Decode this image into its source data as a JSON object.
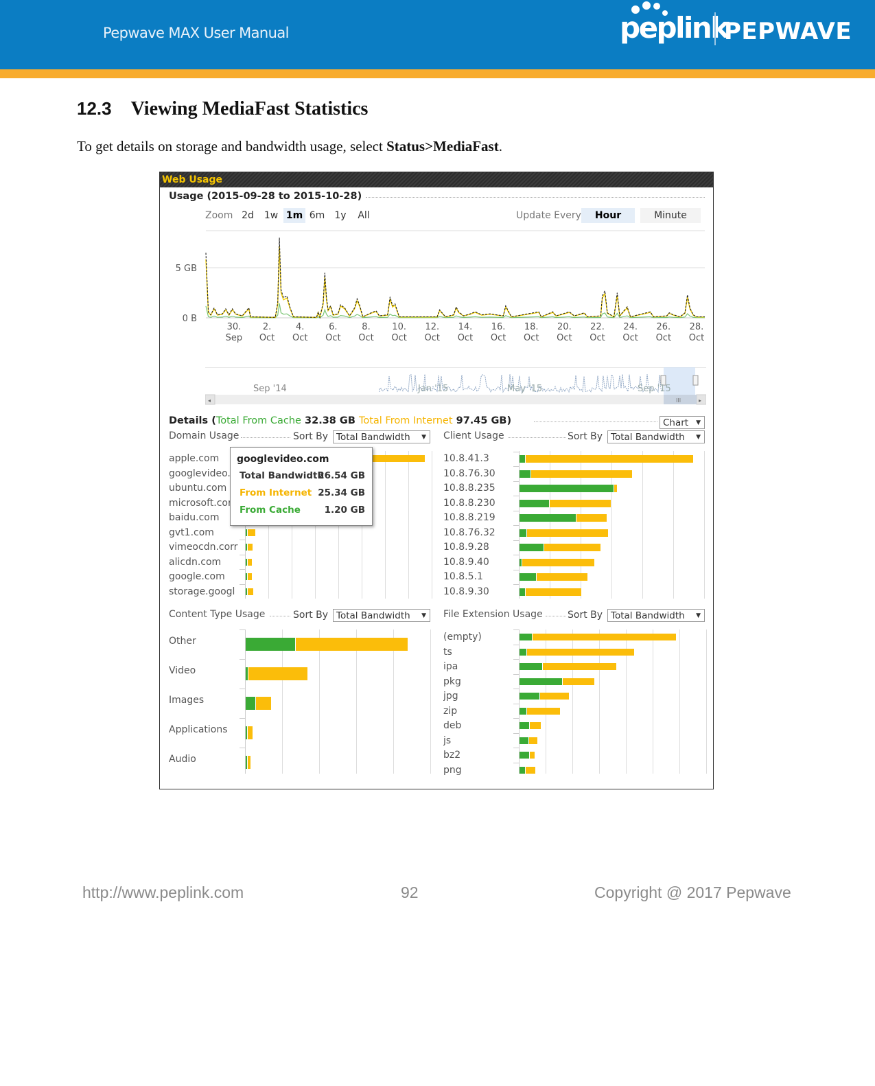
{
  "header": {
    "manual_title": "Pepwave MAX User Manual",
    "logo_left": "peplink",
    "logo_right": "PEPWAVE",
    "colors": {
      "band": "#0b7dc3",
      "strip": "#f8ac2e"
    }
  },
  "section": {
    "number": "12.3",
    "title": "Viewing MediaFast Statistics",
    "intro_prefix": "To get details on storage and bandwidth usage, select ",
    "intro_bold": "Status>MediaFast",
    "intro_suffix": "."
  },
  "panel": {
    "title": "Web Usage",
    "usage_heading": "Usage (2015-09-28 to 2015-10-28)",
    "zoom_label": "Zoom",
    "zoom_options": [
      "2d",
      "1w",
      "1m",
      "6m",
      "1y",
      "All"
    ],
    "zoom_active": "1m",
    "update_label": "Update Every",
    "update_options": [
      "Hour",
      "Minute"
    ],
    "update_active": "Hour",
    "navigator_labels": [
      "Sep '14",
      "Jan '15",
      "May '15",
      "Sep '15"
    ],
    "details": {
      "prefix": "Details (",
      "cache_label": "Total From Cache",
      "cache_value": "32.38 GB",
      "internet_label": "Total From Internet",
      "internet_value": "97.45 GB",
      "suffix": ")",
      "view_select": "Chart"
    },
    "sort_by_label": "Sort By",
    "sort_value": "Total Bandwidth",
    "colors": {
      "cache": "#3aaa35",
      "internet": "#fbbd0a",
      "total_line": "#222222"
    }
  },
  "chart_data": [
    {
      "type": "line",
      "title": "Usage (2015-09-28 to 2015-10-28)",
      "ylabel": "",
      "y_ticks": [
        "0 B",
        "5 GB"
      ],
      "ylim_gb": [
        0,
        8.5
      ],
      "x_ticks": [
        "30. Sep",
        "2. Oct",
        "4. Oct",
        "6. Oct",
        "8. Oct",
        "10. Oct",
        "12. Oct",
        "14. Oct",
        "16. Oct",
        "18. Oct",
        "20. Oct",
        "22. Oct",
        "24. Oct",
        "26. Oct",
        "28. Oct"
      ],
      "x_range_days": [
        28.3,
        58.5
      ],
      "series": [
        {
          "name": "Total",
          "style": "dashed-black",
          "points": [
            [
              28.3,
              6.5
            ],
            [
              28.45,
              0.6
            ],
            [
              28.6,
              0.3
            ],
            [
              28.8,
              1.0
            ],
            [
              29.0,
              0.3
            ],
            [
              29.3,
              0.4
            ],
            [
              29.5,
              0.9
            ],
            [
              29.7,
              0.3
            ],
            [
              29.9,
              0.9
            ],
            [
              30.1,
              0.4
            ],
            [
              30.5,
              0.2
            ],
            [
              30.9,
              1.0
            ],
            [
              31.0,
              0.1
            ],
            [
              32.5,
              0.05
            ],
            [
              32.65,
              1.5
            ],
            [
              32.75,
              8.0
            ],
            [
              32.85,
              2.8
            ],
            [
              33.0,
              2.0
            ],
            [
              33.2,
              2.2
            ],
            [
              33.4,
              1.0
            ],
            [
              33.6,
              0.1
            ],
            [
              35.0,
              0.05
            ],
            [
              35.1,
              0.6
            ],
            [
              35.2,
              0.05
            ],
            [
              35.4,
              1.5
            ],
            [
              35.5,
              4.5
            ],
            [
              35.6,
              2.0
            ],
            [
              35.7,
              0.8
            ],
            [
              35.85,
              1.2
            ],
            [
              36.0,
              0.3
            ],
            [
              36.3,
              0.4
            ],
            [
              36.45,
              1.3
            ],
            [
              36.7,
              1.0
            ],
            [
              37.0,
              0.2
            ],
            [
              37.3,
              1.0
            ],
            [
              37.45,
              1.9
            ],
            [
              37.6,
              1.3
            ],
            [
              37.8,
              0.1
            ],
            [
              38.3,
              0.5
            ],
            [
              38.6,
              0.7
            ],
            [
              38.8,
              0.2
            ],
            [
              39.3,
              0.3
            ],
            [
              39.45,
              2.1
            ],
            [
              39.6,
              1.2
            ],
            [
              39.75,
              1.4
            ],
            [
              40.0,
              0.1
            ],
            [
              42.3,
              0.1
            ],
            [
              42.45,
              0.8
            ],
            [
              42.6,
              0.5
            ],
            [
              42.8,
              0.1
            ],
            [
              43.3,
              0.3
            ],
            [
              43.45,
              1.1
            ],
            [
              43.6,
              0.6
            ],
            [
              43.9,
              0.2
            ],
            [
              44.3,
              0.4
            ],
            [
              44.6,
              0.6
            ],
            [
              45.0,
              0.3
            ],
            [
              45.5,
              0.4
            ],
            [
              46.3,
              0.2
            ],
            [
              46.45,
              1.2
            ],
            [
              46.6,
              0.7
            ],
            [
              46.8,
              0.1
            ],
            [
              48.45,
              0.6
            ],
            [
              48.6,
              0.1
            ],
            [
              49.3,
              0.6
            ],
            [
              49.5,
              0.2
            ],
            [
              50.1,
              0.5
            ],
            [
              50.3,
              0.6
            ],
            [
              50.6,
              0.2
            ],
            [
              51.2,
              0.5
            ],
            [
              51.4,
              0.1
            ],
            [
              52.2,
              0.2
            ],
            [
              52.3,
              2.2
            ],
            [
              52.45,
              2.7
            ],
            [
              52.6,
              0.5
            ],
            [
              53.0,
              0.1
            ],
            [
              53.2,
              2.5
            ],
            [
              53.35,
              0.2
            ],
            [
              53.6,
              0.7
            ],
            [
              53.8,
              1.1
            ],
            [
              54.0,
              0.1
            ],
            [
              55.2,
              0.6
            ],
            [
              55.4,
              0.1
            ],
            [
              56.2,
              0.2
            ],
            [
              56.35,
              0.5
            ],
            [
              56.6,
              0.3
            ],
            [
              57.0,
              0.1
            ],
            [
              57.3,
              0.5
            ],
            [
              57.45,
              2.3
            ],
            [
              57.6,
              1.0
            ],
            [
              57.8,
              0.3
            ],
            [
              58.0,
              0.1
            ],
            [
              58.5,
              0.1
            ]
          ]
        },
        {
          "name": "From Internet",
          "style": "yellow",
          "note": "closely follows Total, slightly lower"
        },
        {
          "name": "From Cache",
          "style": "green",
          "note": "mostly near zero with small bumps"
        }
      ]
    },
    {
      "type": "bar",
      "stacked": true,
      "orientation": "horizontal",
      "title": "Domain Usage",
      "categories": [
        "apple.com",
        "googlevideo.com",
        "ubuntu.com",
        "microsoft.com",
        "baidu.com",
        "gvt1.com",
        "vimeocdn.com",
        "alicdn.com",
        "google.com",
        "storage.googleapis.com"
      ],
      "category_labels_shown": [
        "apple.com",
        "googlevideo.",
        "ubuntu.com",
        "microsoft.cor",
        "baidu.com",
        "gvt1.com",
        "vimeocdn.corr",
        "alicdn.com",
        "google.com",
        "storage.googl"
      ],
      "series": [
        {
          "name": "From Cache",
          "values_gb": [
            0.3,
            1.2,
            0.2,
            0.2,
            0.1,
            0.05,
            0.3,
            0.2,
            0.1,
            0.1
          ]
        },
        {
          "name": "From Internet",
          "values_gb": [
            53.5,
            25.34,
            16,
            12,
            8,
            2.3,
            1.6,
            1.3,
            1.4,
            1.7
          ]
        }
      ],
      "tooltip": {
        "title": "googlevideo.com",
        "rows": [
          {
            "label": "Total Bandwidth",
            "value": "26.54 GB"
          },
          {
            "label": "From Internet",
            "value": "25.34 GB"
          },
          {
            "label": "From Cache",
            "value": "1.20 GB"
          }
        ]
      },
      "xlim_gb": [
        0,
        60
      ]
    },
    {
      "type": "bar",
      "stacked": true,
      "orientation": "horizontal",
      "title": "Client Usage",
      "categories": [
        "10.8.41.3",
        "10.8.76.30",
        "10.8.8.235",
        "10.8.8.230",
        "10.8.8.219",
        "10.8.76.32",
        "10.8.9.28",
        "10.8.9.40",
        "10.8.5.1",
        "10.8.9.30"
      ],
      "series": [
        {
          "name": "From Cache",
          "values_rel": [
            0.7,
            1.4,
            12.2,
            3.8,
            7.3,
            0.9,
            3.1,
            0.3,
            2.1,
            0.7
          ]
        },
        {
          "name": "From Internet",
          "values_rel": [
            21.7,
            13.1,
            0.3,
            7.9,
            3.9,
            10.5,
            7.3,
            9.3,
            6.6,
            7.2
          ]
        }
      ],
      "xlim_rel": [
        0,
        24
      ]
    },
    {
      "type": "bar",
      "stacked": true,
      "orientation": "horizontal",
      "title": "Content Type Usage",
      "categories": [
        "Other",
        "Video",
        "Images",
        "Applications",
        "Audio"
      ],
      "series": [
        {
          "name": "From Cache",
          "values_rel": [
            13.3,
            0.6,
            2.5,
            0.3,
            0.3
          ]
        },
        {
          "name": "From Internet",
          "values_rel": [
            30.3,
            15.9,
            4.2,
            1.4,
            0.9
          ]
        }
      ],
      "xlim_rel": [
        0,
        50
      ]
    },
    {
      "type": "bar",
      "stacked": true,
      "orientation": "horizontal",
      "title": "File Extension Usage",
      "categories": [
        "(empty)",
        "ts",
        "ipa",
        "pkg",
        "jpg",
        "zip",
        "deb",
        "js",
        "bz2",
        "png"
      ],
      "series": [
        {
          "name": "From Cache",
          "values_rel": [
            1.4,
            0.8,
            2.5,
            4.8,
            2.2,
            0.8,
            1.1,
            1.0,
            1.1,
            0.6
          ],
          "note": "values in gridline units"
        },
        {
          "name": "From Internet",
          "values_rel": [
            16.1,
            12.0,
            8.3,
            3.5,
            3.3,
            3.7,
            1.2,
            0.9,
            0.5,
            1.1
          ]
        }
      ],
      "xlim_rel": [
        0,
        21
      ]
    }
  ],
  "footer": {
    "url": "http://www.peplink.com",
    "page": "92",
    "copyright": "Copyright @ 2017 Pepwave"
  }
}
